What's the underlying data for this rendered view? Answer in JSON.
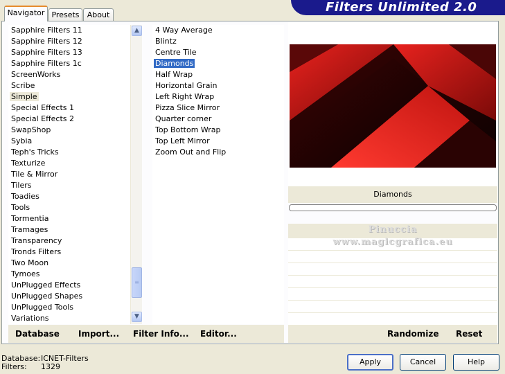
{
  "tabs": [
    "Navigator",
    "Presets",
    "About"
  ],
  "title": "Filters Unlimited 2.0",
  "categories": [
    "Sapphire Filters 11",
    "Sapphire Filters 12",
    "Sapphire Filters 13",
    "Sapphire Filters 1c",
    "ScreenWorks",
    "Scribe",
    "Simple",
    "Special Effects 1",
    "Special Effects 2",
    "SwapShop",
    "Sybia",
    "Teph's Tricks",
    "Texturize",
    "Tile & Mirror",
    "Tilers",
    "Toadies",
    "Tools",
    "Tormentia",
    "Tramages",
    "Transparency",
    "Tronds Filters",
    "Two Moon",
    "Tymoes",
    "UnPlugged Effects",
    "UnPlugged Shapes",
    "UnPlugged Tools",
    "Variations"
  ],
  "selected_category": "Simple",
  "filters": [
    "4 Way Average",
    "Blintz",
    "Centre Tile",
    "Diamonds",
    "Half Wrap",
    "Horizontal Grain",
    "Left Right Wrap",
    "Pizza Slice Mirror",
    "Quarter corner",
    "Top Bottom Wrap",
    "Top Left Mirror",
    "Zoom Out and Flip"
  ],
  "selected_filter": "Diamonds",
  "left_buttons": {
    "database": "Database",
    "import": "Import...",
    "filter_info": "Filter Info...",
    "editor": "Editor..."
  },
  "right_buttons": {
    "randomize": "Randomize",
    "reset": "Reset"
  },
  "preview": {
    "filter_name": "Diamonds",
    "watermark_line1": "Pinuccia",
    "watermark_line2": "www.magicgrafica.eu",
    "colors": {
      "dark": "#1a0303",
      "mid": "#8c0a0a",
      "bright": "#e01a1a"
    }
  },
  "status": {
    "database_label": "Database:",
    "database_value": "ICNET-Filters",
    "filters_label": "Filters:",
    "filters_value": "1329"
  },
  "dialog": {
    "apply": "Apply",
    "cancel": "Cancel",
    "help": "Help"
  },
  "accent_color": "#316ac5"
}
